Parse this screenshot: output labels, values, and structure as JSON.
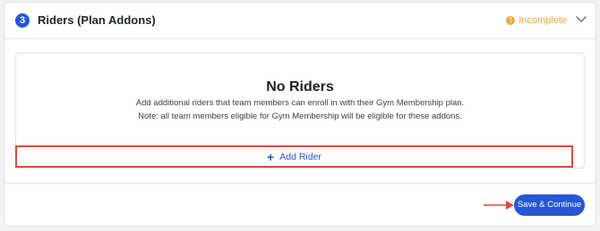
{
  "section": {
    "step_number": "3",
    "title": "Riders (Plan Addons)",
    "status_label": "Incomplete",
    "status_icon": "info-icon",
    "collapse_icon": "chevron-down-icon"
  },
  "empty_state": {
    "title": "No Riders",
    "description_line_1": "Add additional riders that team members can enroll in with their Gym Membership plan.",
    "description_line_2": "Note: all team members eligible for Gym Membership will be eligible for these addons."
  },
  "add_rider": {
    "icon": "plus-icon",
    "label": "Add Rider"
  },
  "footer": {
    "save_label": "Save & Continue"
  },
  "colors": {
    "accent": "#2557d6",
    "warning": "#f2a93b",
    "highlight": "#e04a3b"
  }
}
